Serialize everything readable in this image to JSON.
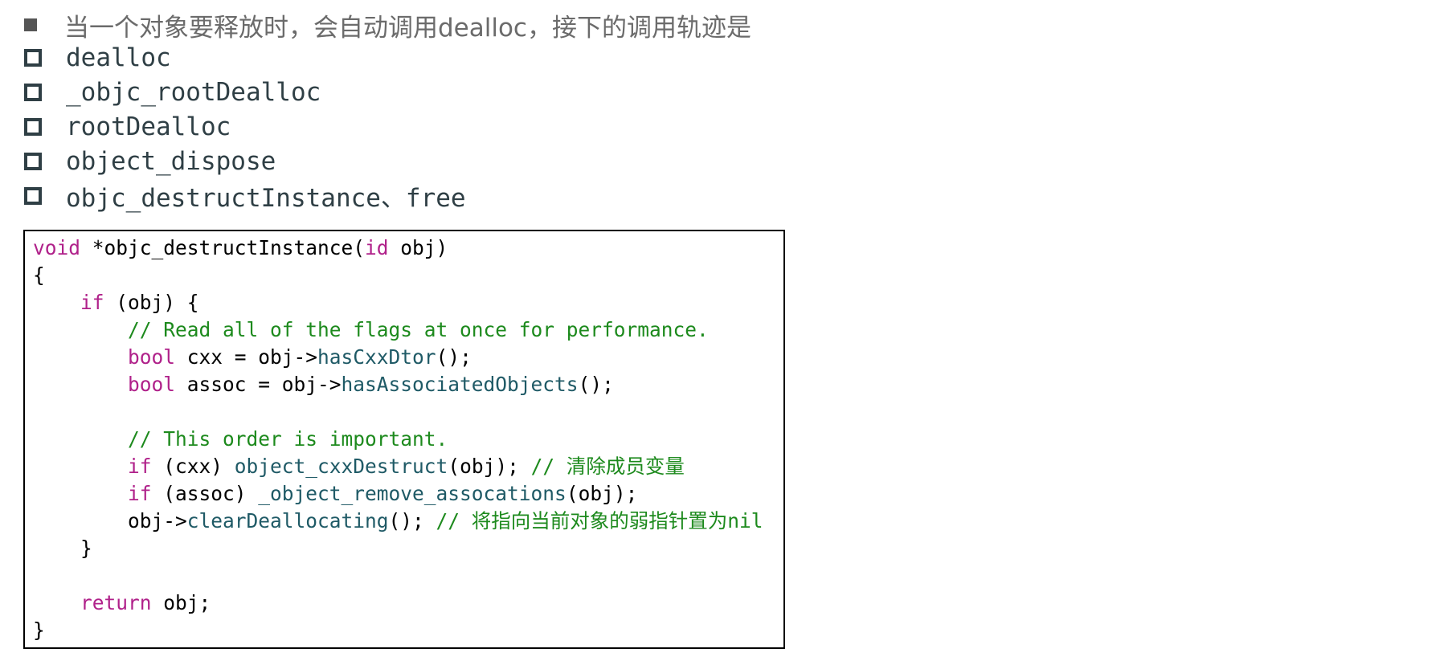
{
  "heading": {
    "text": "当一个对象要释放时，会自动调用dealloc，接下的调用轨迹是"
  },
  "trace": [
    "dealloc",
    "_objc_rootDealloc",
    "rootDealloc",
    "object_dispose",
    "objc_destructInstance、free"
  ],
  "code": {
    "lines": [
      [
        {
          "t": "kw",
          "v": "void"
        },
        {
          "t": "pl",
          "v": " *objc_destructInstance("
        },
        {
          "t": "kw",
          "v": "id"
        },
        {
          "t": "pl",
          "v": " obj)"
        }
      ],
      [
        {
          "t": "pl",
          "v": "{"
        }
      ],
      [
        {
          "t": "pl",
          "v": "    "
        },
        {
          "t": "kw",
          "v": "if"
        },
        {
          "t": "pl",
          "v": " (obj) {"
        }
      ],
      [
        {
          "t": "pl",
          "v": "        "
        },
        {
          "t": "cm",
          "v": "// Read all of the flags at once for performance."
        }
      ],
      [
        {
          "t": "pl",
          "v": "        "
        },
        {
          "t": "kw",
          "v": "bool"
        },
        {
          "t": "pl",
          "v": " cxx = obj->"
        },
        {
          "t": "fn",
          "v": "hasCxxDtor"
        },
        {
          "t": "pl",
          "v": "();"
        }
      ],
      [
        {
          "t": "pl",
          "v": "        "
        },
        {
          "t": "kw",
          "v": "bool"
        },
        {
          "t": "pl",
          "v": " assoc = obj->"
        },
        {
          "t": "fn",
          "v": "hasAssociatedObjects"
        },
        {
          "t": "pl",
          "v": "();"
        }
      ],
      [
        {
          "t": "pl",
          "v": ""
        }
      ],
      [
        {
          "t": "pl",
          "v": "        "
        },
        {
          "t": "cm",
          "v": "// This order is important."
        }
      ],
      [
        {
          "t": "pl",
          "v": "        "
        },
        {
          "t": "kw",
          "v": "if"
        },
        {
          "t": "pl",
          "v": " (cxx) "
        },
        {
          "t": "fn",
          "v": "object_cxxDestruct"
        },
        {
          "t": "pl",
          "v": "(obj); "
        },
        {
          "t": "cm",
          "v": "// 清除成员变量"
        }
      ],
      [
        {
          "t": "pl",
          "v": "        "
        },
        {
          "t": "kw",
          "v": "if"
        },
        {
          "t": "pl",
          "v": " (assoc) "
        },
        {
          "t": "fn",
          "v": "_object_remove_assocations"
        },
        {
          "t": "pl",
          "v": "(obj);"
        }
      ],
      [
        {
          "t": "pl",
          "v": "        obj->"
        },
        {
          "t": "fn",
          "v": "clearDeallocating"
        },
        {
          "t": "pl",
          "v": "(); "
        },
        {
          "t": "cm",
          "v": "// 将指向当前对象的弱指针置为nil"
        }
      ],
      [
        {
          "t": "pl",
          "v": "    }"
        }
      ],
      [
        {
          "t": "pl",
          "v": ""
        }
      ],
      [
        {
          "t": "pl",
          "v": "    "
        },
        {
          "t": "kw",
          "v": "return"
        },
        {
          "t": "pl",
          "v": " obj;"
        }
      ],
      [
        {
          "t": "pl",
          "v": "}"
        }
      ]
    ]
  }
}
